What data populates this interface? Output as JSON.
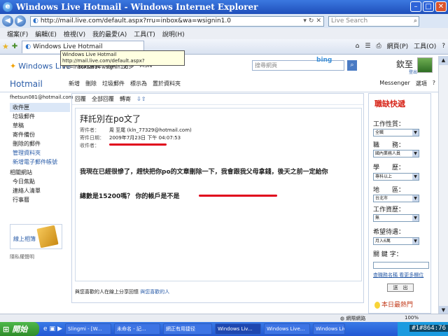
{
  "window": {
    "title": "Windows Live Hotmail - Windows Internet Explorer"
  },
  "address": {
    "url": "http://mail.live.com/default.aspx?rru=inbox&wa=wsignin1.0",
    "search_placeholder": "Live Search"
  },
  "menu": [
    "檔案(F)",
    "編輯(E)",
    "檢視(V)",
    "我的最愛(A)",
    "工具(T)",
    "說明(H)"
  ],
  "tab": {
    "label": "Windows Live Hotmail",
    "tooltip_title": "Windows Live Hotmail",
    "tooltip_url": "http://mail.live.com/default.aspx?rru=inbox&wa=wsignin1.0"
  },
  "commands": {
    "page": "網頁(P)",
    "tools": "工具(O)"
  },
  "live": {
    "logo": "Windows Live",
    "nav": [
      "我的首頁",
      "相片",
      "更多",
      "MSN"
    ],
    "search_placeholder": "搜尋網頁",
    "bing": "bing",
    "user": "欽至",
    "logout": "登出"
  },
  "hotmail": {
    "title": "Hotmail",
    "commands": [
      "新增",
      "刪除",
      "垃圾郵件",
      "標示為",
      "置於資料夾"
    ],
    "messenger": "Messenger",
    "options": "選項"
  },
  "leftnav": {
    "account": "fhetsun081@hotmail.com",
    "folders": [
      "收件匣",
      "垃圾郵件",
      "草稿",
      "寄件備份",
      "刪除的郵件"
    ],
    "links": [
      "管理資料夾",
      "新增電子郵件帳號"
    ],
    "related_title": "相關網站",
    "related": [
      "今日焦點",
      "連絡人清單",
      "行事曆"
    ],
    "promo": "線上相簿",
    "privacy": "隱私權聲明"
  },
  "message": {
    "commands": [
      "回覆",
      "全部回覆",
      "轉寄"
    ],
    "subject": "拜託別在po文了",
    "headers": [
      {
        "k": "寄件者：",
        "v": "周 至尾 (kln_77329@hotmail.com)"
      },
      {
        "k": "寄件日期：",
        "v": "2009年7月23日 下午 04:07:53"
      },
      {
        "k": "收件者：",
        "v": ""
      }
    ],
    "body_line1": "我現在已經很慘了，趕快把你po的文章刪除一下，我會跟我父母拿錢，後天之前一定給你",
    "body_line2": "總數是15200嗎？  你的帳戶是不是",
    "footer_text": "與您喜歡的人在線上分享回憶",
    "footer_link": "與您喜歡的人"
  },
  "ad": {
    "title": "職缺快遞",
    "fields": [
      {
        "label": "工作性質：",
        "value": "全職"
      },
      {
        "label": "職　　務：",
        "value": "國內業務人員"
      },
      {
        "label": "學　　歷：",
        "value": "專科以上"
      },
      {
        "label": "地　　區：",
        "value": "台北市"
      },
      {
        "label": "工作資歷：",
        "value": "無"
      },
      {
        "label": "希望待遇：",
        "value": "月入6萬"
      }
    ],
    "keyword_label": "關 鍵 字：",
    "link": "查職務名稱 看更多欄位",
    "button": "送　出",
    "hot": "本日最熱門"
  },
  "status": {
    "zone": "網際網路",
    "zoom": "100%"
  },
  "taskbar": {
    "start": "開始",
    "tasks": [
      "Slingmi - [W...",
      "未命名 - 記...",
      "網正有用捷径",
      "Windows Liv...",
      "Windows Live...",
      "Windows Liv..."
    ]
  },
  "watermark": "#1#864:76"
}
